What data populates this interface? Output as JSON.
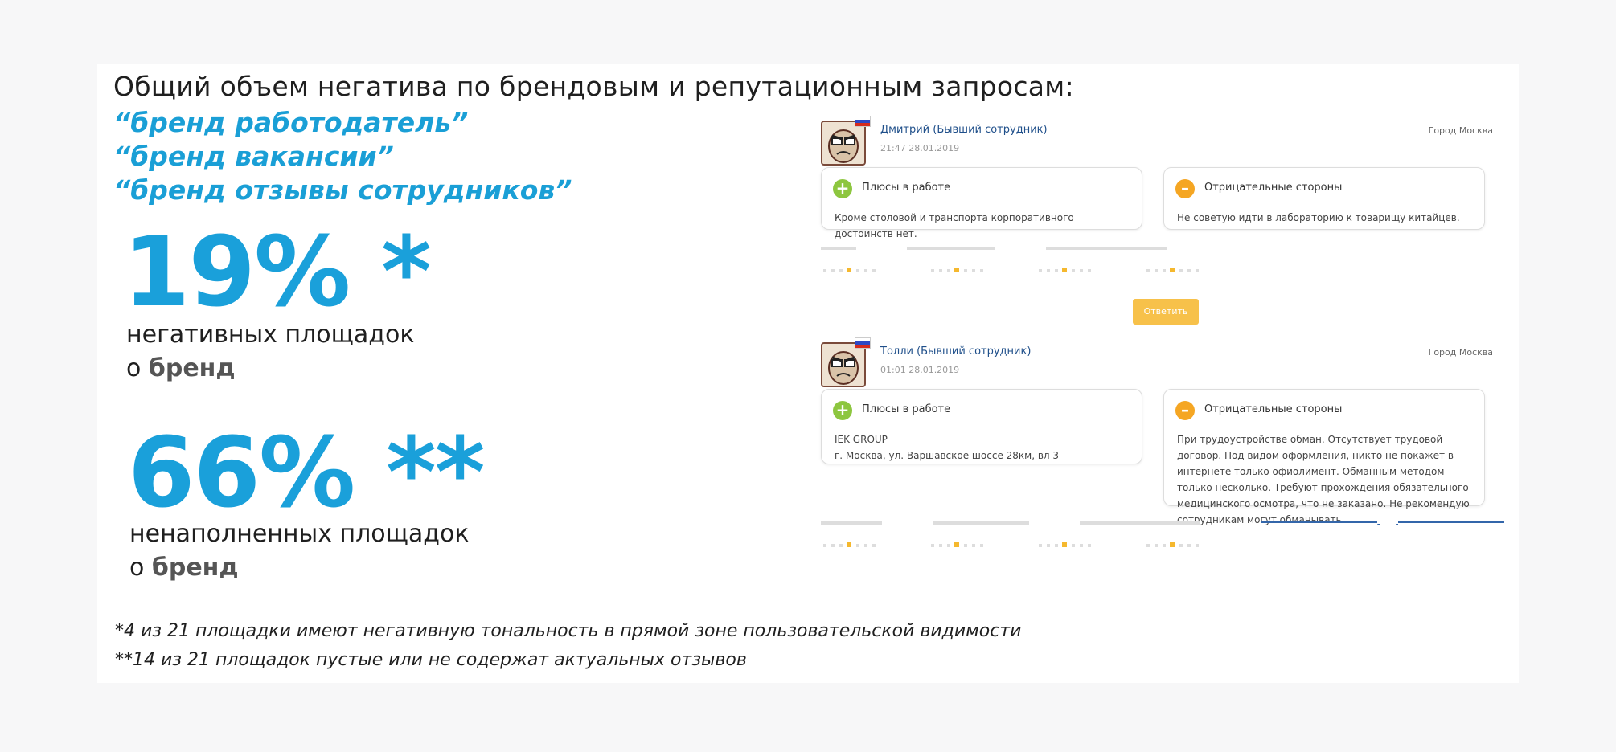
{
  "heading": "Общий объем негатива по брендовым и репутационным запросам:",
  "queries": [
    "“бренд работодатель”",
    "“бренд вакансии”",
    "“бренд отзывы сотрудников”"
  ],
  "stat1": {
    "value": "19% *",
    "line1": "негативных площадок",
    "line2_prefix": "о ",
    "line2_bold": "бренд"
  },
  "stat2": {
    "value": "66% **",
    "line1": "ненаполненных площадок",
    "line2_prefix": "о ",
    "line2_bold": "бренд"
  },
  "notes": [
    "*4 из 21 площадки имеют негативную тональность в прямой зоне пользовательской видимости",
    "**14 из 21 площадок пустые или не содержат актуальных отзывов"
  ],
  "reviews": [
    {
      "name": "Дмитрий (Бывший сотрудник)",
      "date": "21:47 28.01.2019",
      "city": "Город Москва",
      "plus_title": "Плюсы в работе",
      "plus_text": "Кроме столовой и транспорта корпоративного достоинств нет.",
      "minus_title": "Отрицательные стороны",
      "minus_text": "Не советую идти в лабораторию к товарищу китайцев."
    },
    {
      "name": "Толли (Бывший сотрудник)",
      "date": "01:01 28.01.2019",
      "city": "Город Москва",
      "plus_title": "Плюсы в работе",
      "plus_text_1": "IEK GROUP",
      "plus_text_2": "г. Москва, ул. Варшавское шоссе 28км, вл 3",
      "minus_title": "Отрицательные стороны",
      "minus_text": "При трудоустройстве обман. Отсутствует трудовой договор. Под видом оформления, никто не покажет в интернете только офиолимент. Обманным методом только несколько. Требуют прохождения обязательного медицинского осмотра, что не заказано. Не рекомендую сотрудникам могут обманывать."
    }
  ],
  "answer_label": "Ответить",
  "colors": {
    "accent": "#1aa0da",
    "answer": "#f7c14a",
    "plus": "#8dc63f",
    "minus": "#f5a623"
  }
}
